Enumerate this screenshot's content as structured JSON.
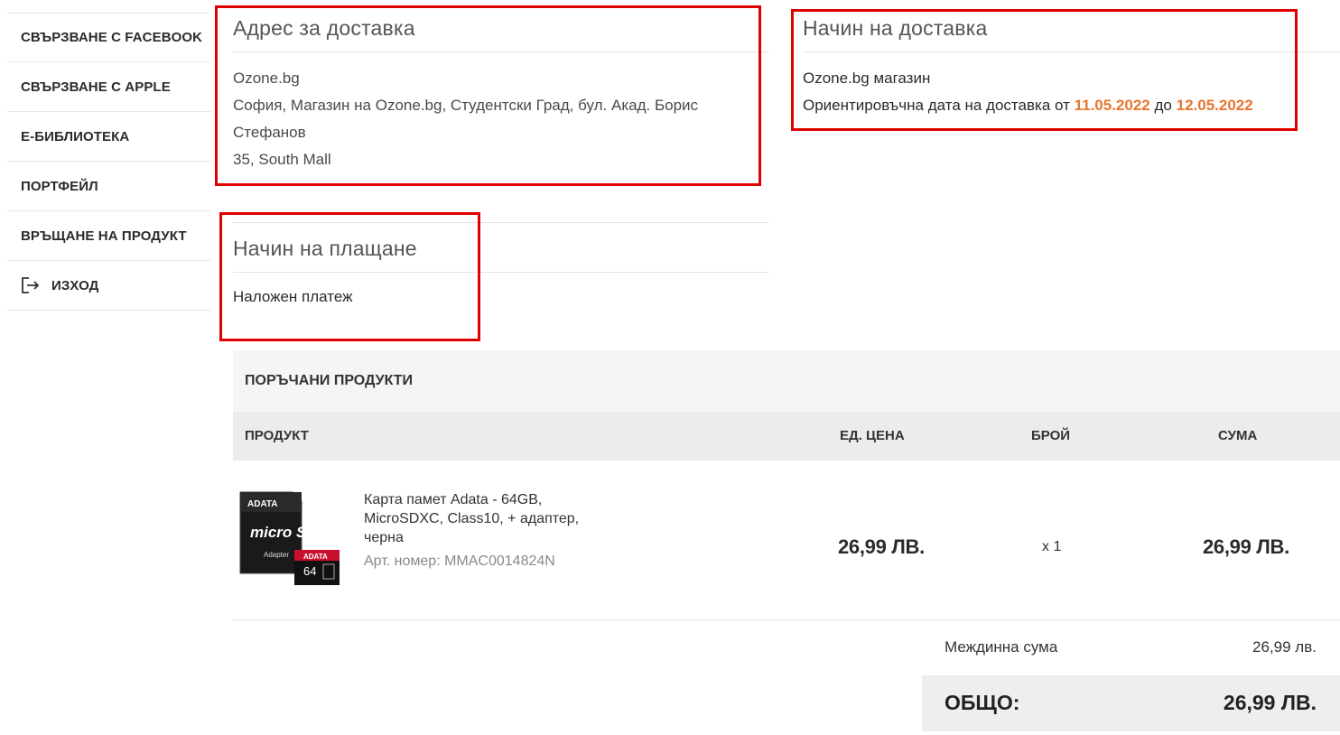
{
  "sidebar": {
    "items": [
      {
        "label": "СВЪРЗВАНЕ С FACEBOOK"
      },
      {
        "label": "СВЪРЗВАНЕ С APPLE"
      },
      {
        "label": "Е-БИБЛИОТЕКА"
      },
      {
        "label": "ПОРТФЕЙЛ"
      },
      {
        "label": "ВРЪЩАНЕ НА ПРОДУКТ"
      },
      {
        "label": "ИЗХОД",
        "icon": "logout-icon"
      }
    ]
  },
  "address": {
    "title": "Адрес за доставка",
    "name": "Ozone.bg",
    "line1": "София, Магазин на Ozone.bg, Студентски Град, бул. Акад. Борис Стефанов",
    "line2": "35, South Mall"
  },
  "delivery": {
    "title": "Начин на доставка",
    "method": "Ozone.bg магазин",
    "eta_prefix": "Ориентировъчна дата на доставка от",
    "date_from": "11.05.2022",
    "eta_mid": "до",
    "date_to": "12.05.2022"
  },
  "payment": {
    "title": "Начин на плащане",
    "method": "Наложен платеж"
  },
  "products": {
    "section_title": "ПОРЪЧАНИ ПРОДУКТИ",
    "columns": {
      "product": "ПРОДУКТ",
      "unit_price": "ЕД. ЦЕНА",
      "qty": "БРОЙ",
      "sum": "СУМА"
    },
    "items": [
      {
        "name": "Карта памет Adata - 64GB, MicroSDXC, Class10, + адаптер, черна",
        "sku": "Арт. номер: MMAC0014824N",
        "unit_price": "26,99 ЛВ.",
        "qty": "x 1",
        "sum": "26,99 ЛВ.",
        "image": {
          "brand": "ADATA",
          "capacity": "64",
          "card_label": "micro SD",
          "adapter_label": "Adapter"
        }
      }
    ]
  },
  "summary": {
    "subtotal_label": "Междинна сума",
    "subtotal_value": "26,99 лв.",
    "total_label": "ОБЩО:",
    "total_value": "26,99 ЛВ."
  },
  "colors": {
    "accent_orange": "#e8752e",
    "highlight_red": "#e00000"
  }
}
